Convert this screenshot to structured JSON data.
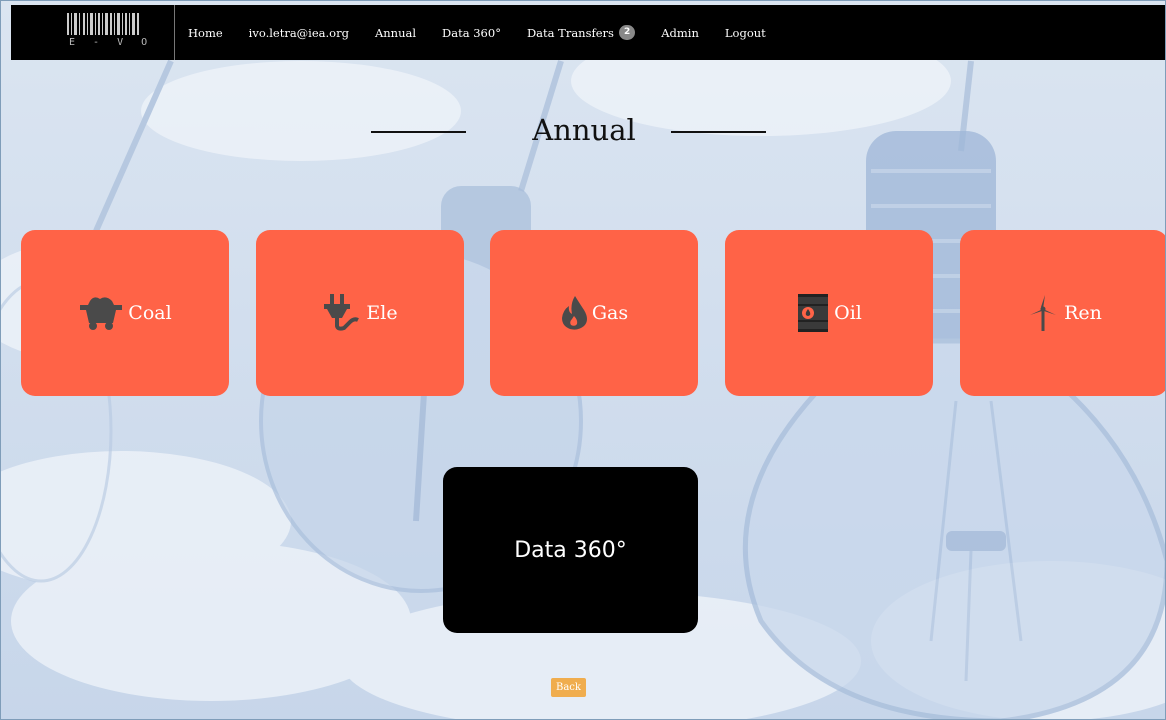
{
  "nav": {
    "logo_text": "E - V O",
    "links": [
      {
        "label": "Home"
      },
      {
        "label": "ivo.letra@iea.org"
      },
      {
        "label": "Annual"
      },
      {
        "label": "Data 360°"
      },
      {
        "label": "Data Transfers",
        "badge": "2"
      },
      {
        "label": "Admin"
      },
      {
        "label": "Logout"
      }
    ]
  },
  "page_title": "Annual",
  "cards": [
    {
      "label": "Coal",
      "icon": "coal-cart-icon"
    },
    {
      "label": "Ele",
      "icon": "plug-icon"
    },
    {
      "label": "Gas",
      "icon": "flame-icon"
    },
    {
      "label": "Oil",
      "icon": "oil-barrel-icon"
    },
    {
      "label": "Ren",
      "icon": "wind-turbine-icon"
    }
  ],
  "data360_label": "Data 360°",
  "back_label": "Back",
  "colors": {
    "card": "#ff6347",
    "nav": "#000000",
    "data360": "#000000",
    "back_button": "#f0ad4e",
    "badge": "#888888"
  }
}
